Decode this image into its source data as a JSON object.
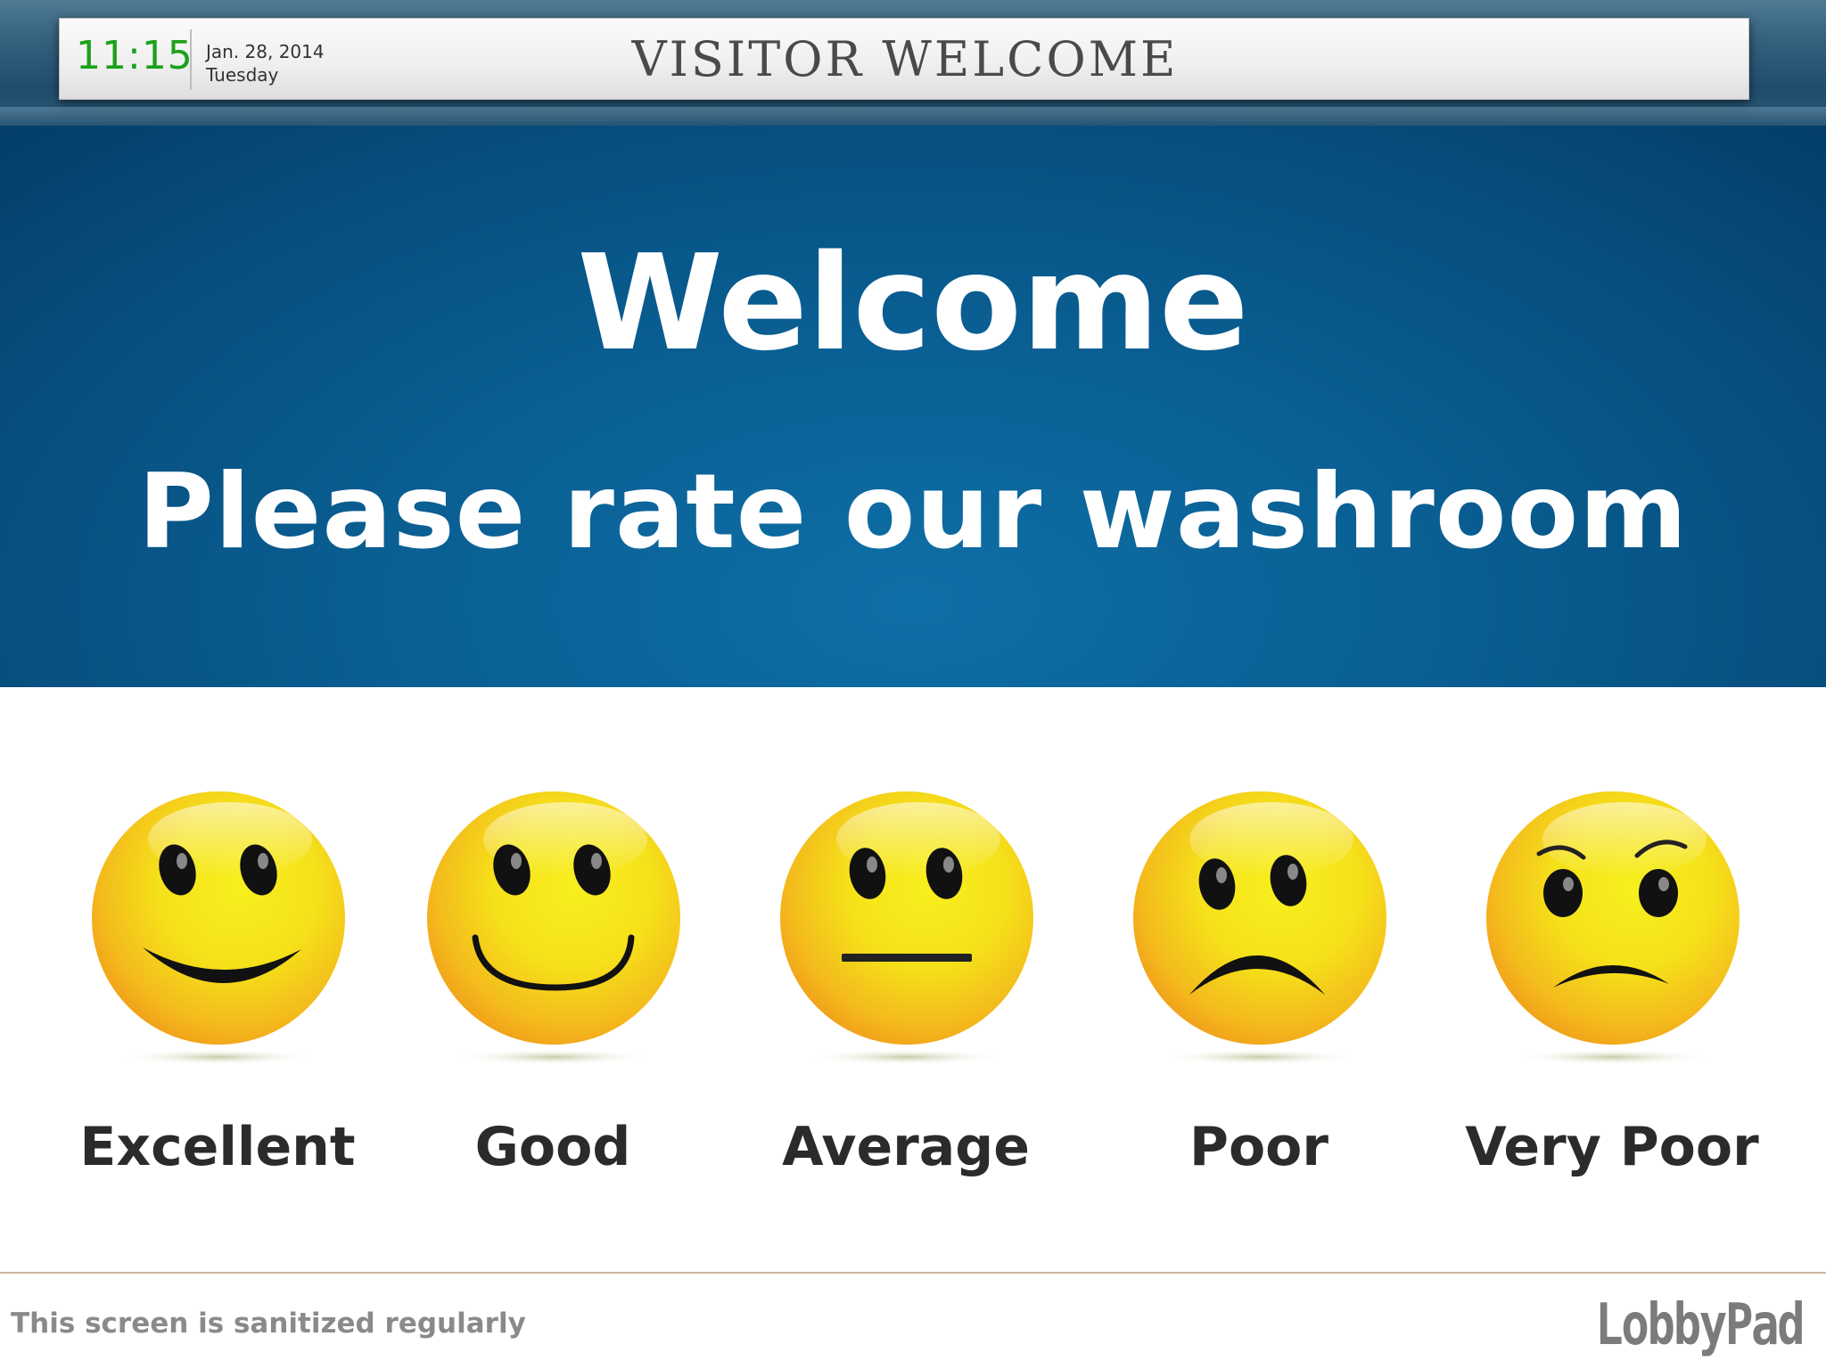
{
  "header": {
    "time": "11:15",
    "date": "Jan. 28, 2014",
    "day": "Tuesday",
    "title": "VISITOR WELCOME"
  },
  "hero": {
    "heading": "Welcome",
    "prompt": "Please rate our washroom"
  },
  "ratings": [
    {
      "label": "Excellent",
      "icon": "grinning-face-icon"
    },
    {
      "label": "Good",
      "icon": "smiling-face-icon"
    },
    {
      "label": "Average",
      "icon": "neutral-face-icon"
    },
    {
      "label": "Poor",
      "icon": "frowning-face-icon"
    },
    {
      "label": "Very Poor",
      "icon": "angry-face-icon"
    }
  ],
  "footer": {
    "note": "This screen is sanitized regularly",
    "brand": "LobbyPad"
  },
  "colors": {
    "hero_blue": "#0a5f93",
    "clock_green": "#1aa11a",
    "face_yellow": "#f5e21a",
    "face_orange": "#f2a21b"
  }
}
